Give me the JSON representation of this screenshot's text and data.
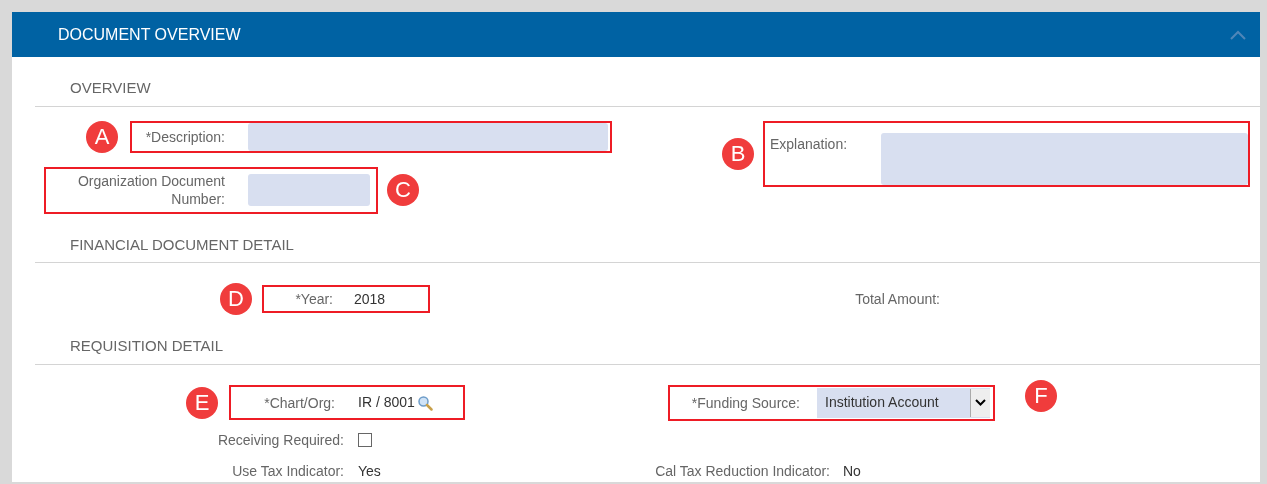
{
  "header": {
    "title": "DOCUMENT OVERVIEW",
    "expanded": true
  },
  "overview": {
    "title": "OVERVIEW",
    "description": {
      "callout": "A",
      "label": "*Description:"
    },
    "explanation": {
      "callout": "B",
      "label": "Explanation:"
    },
    "org_doc_number": {
      "callout": "C",
      "label": "Organization Document Number:"
    }
  },
  "financial": {
    "title": "FINANCIAL DOCUMENT DETAIL",
    "year": {
      "callout": "D",
      "label": "*Year:",
      "value": "2018"
    },
    "total_amount": {
      "label": "Total Amount:"
    }
  },
  "requisition": {
    "title": "REQUISITION DETAIL",
    "chart_org": {
      "callout": "E",
      "label": "*Chart/Org:",
      "value": "IR / 8001"
    },
    "funding_source": {
      "callout": "F",
      "label": "*Funding Source:",
      "value": "Institution Account"
    },
    "receiving_required": {
      "label": "Receiving Required:",
      "checked": false
    },
    "use_tax": {
      "label": "Use Tax Indicator:",
      "value": "Yes"
    },
    "cal_tax": {
      "label": "Cal Tax Reduction Indicator:",
      "value": "No"
    }
  }
}
